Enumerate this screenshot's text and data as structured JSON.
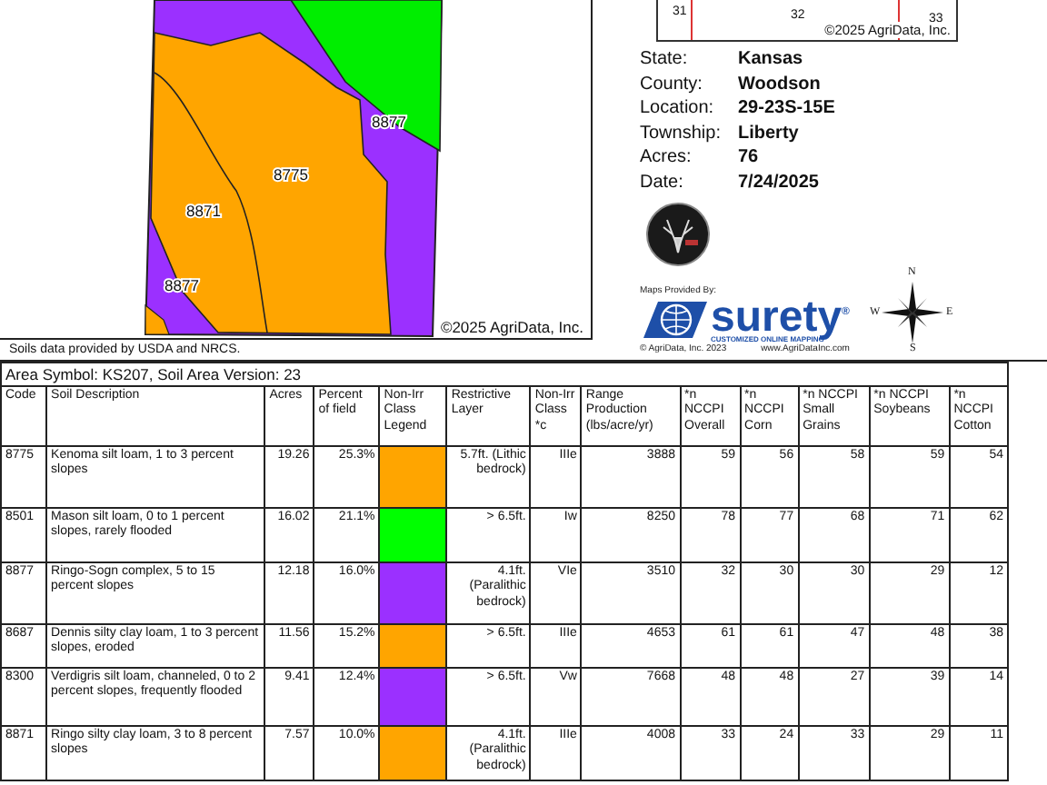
{
  "map": {
    "labels": [
      {
        "text": "8877"
      },
      {
        "text": "8775"
      },
      {
        "text": "8871"
      },
      {
        "text": "8877"
      }
    ],
    "copyright": "©2025 AgriData, Inc."
  },
  "inset_map": {
    "section_labels": [
      "31",
      "32",
      "33"
    ],
    "copyright": "©2025 AgriData, Inc."
  },
  "details": [
    {
      "label": "State:",
      "value": "Kansas"
    },
    {
      "label": "County:",
      "value": "Woodson"
    },
    {
      "label": "Location:",
      "value": "29-23S-15E"
    },
    {
      "label": "Township:",
      "value": "Liberty"
    },
    {
      "label": "Acres:",
      "value": "76"
    },
    {
      "label": "Date:",
      "value": "7/24/2025"
    }
  ],
  "credits": {
    "maps_provided_by": "Maps Provided By:",
    "brand": "surety",
    "registered_mark": "®",
    "tagline": "CUSTOMIZED ONLINE MAPPING",
    "copyright": "© AgriData, Inc. 2023",
    "website": "www.AgriDataInc.com"
  },
  "compass": {
    "n": "N",
    "e": "E",
    "s": "S",
    "w": "W"
  },
  "source_note": "Soils data provided by USDA and NRCS.",
  "table": {
    "title": "Area Symbol: KS207, Soil Area Version: 23",
    "columns": [
      "Code",
      "Soil Description",
      "Acres",
      "Percent of field",
      "Non-Irr Class Legend",
      "Restrictive Layer",
      "Non-Irr Class *c",
      "Range Production (lbs/acre/yr)",
      "*n NCCPI Overall",
      "*n NCCPI Corn",
      "*n NCCPI Small Grains",
      "*n NCCPI Soybeans",
      "*n NCCPI Cotton"
    ],
    "rows": [
      {
        "code": "8775",
        "description": "Kenoma silt loam, 1 to 3 percent slopes",
        "acres": "19.26",
        "percent": "25.3%",
        "color": "#ffa500",
        "restrictive": "5.7ft. (Lithic bedrock)",
        "class": "IIIe",
        "range": "3888",
        "overall": "59",
        "corn": "56",
        "small_grains": "58",
        "soybeans": "59",
        "cotton": "54"
      },
      {
        "code": "8501",
        "description": "Mason silt loam, 0 to 1 percent slopes, rarely flooded",
        "acres": "16.02",
        "percent": "21.1%",
        "color": "#00ff00",
        "restrictive": "> 6.5ft.",
        "class": "Iw",
        "range": "8250",
        "overall": "78",
        "corn": "77",
        "small_grains": "68",
        "soybeans": "71",
        "cotton": "62"
      },
      {
        "code": "8877",
        "description": "Ringo-Sogn complex, 5 to 15 percent slopes",
        "acres": "12.18",
        "percent": "16.0%",
        "color": "#9b30ff",
        "restrictive": "4.1ft. (Paralithic bedrock)",
        "class": "VIe",
        "range": "3510",
        "overall": "32",
        "corn": "30",
        "small_grains": "30",
        "soybeans": "29",
        "cotton": "12"
      },
      {
        "code": "8687",
        "description": "Dennis silty clay loam, 1 to 3 percent slopes, eroded",
        "acres": "11.56",
        "percent": "15.2%",
        "color": "#ffa500",
        "restrictive": "> 6.5ft.",
        "class": "IIIe",
        "range": "4653",
        "overall": "61",
        "corn": "61",
        "small_grains": "47",
        "soybeans": "48",
        "cotton": "38"
      },
      {
        "code": "8300",
        "description": "Verdigris silt loam, channeled, 0 to 2 percent slopes, frequently flooded",
        "acres": "9.41",
        "percent": "12.4%",
        "color": "#9b30ff",
        "restrictive": "> 6.5ft.",
        "class": "Vw",
        "range": "7668",
        "overall": "48",
        "corn": "48",
        "small_grains": "27",
        "soybeans": "39",
        "cotton": "14"
      },
      {
        "code": "8871",
        "description": "Ringo silty clay loam, 3 to 8 percent slopes",
        "acres": "7.57",
        "percent": "10.0%",
        "color": "#ffa500",
        "restrictive": "4.1ft. (Paralithic bedrock)",
        "class": "IIIe",
        "range": "4008",
        "overall": "33",
        "corn": "24",
        "small_grains": "33",
        "soybeans": "29",
        "cotton": "11"
      }
    ]
  }
}
